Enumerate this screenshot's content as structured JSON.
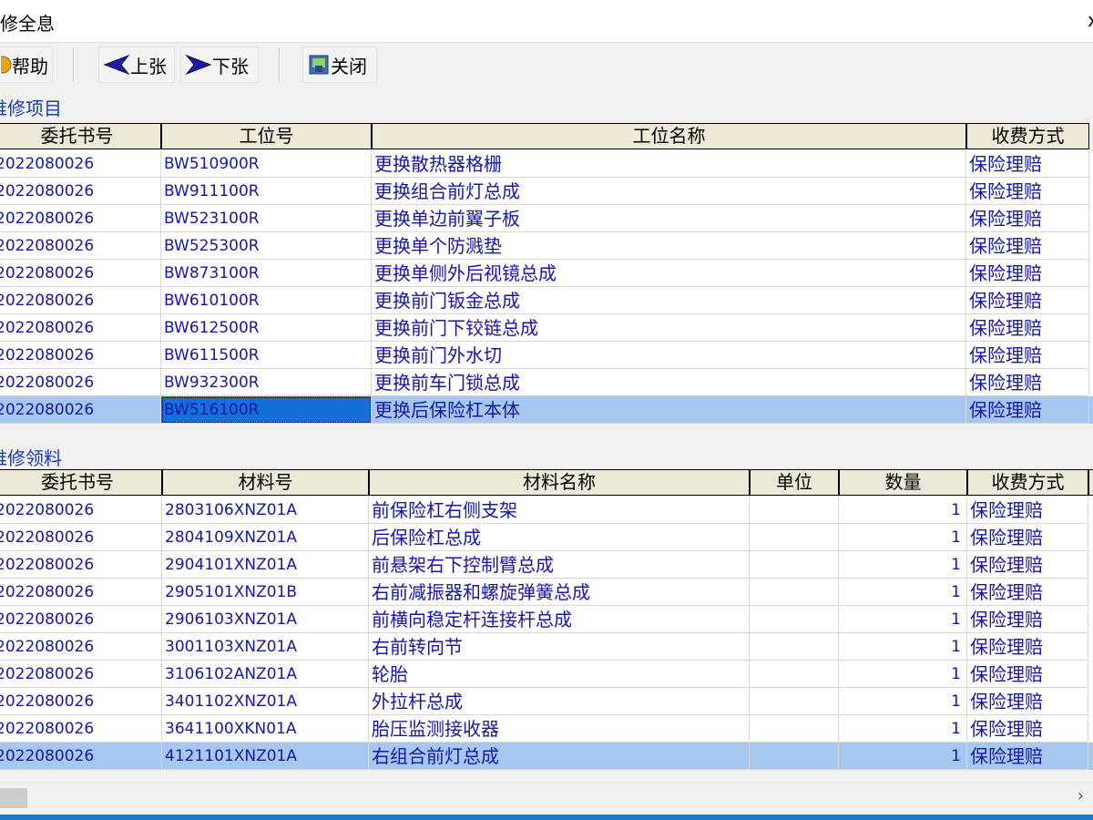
{
  "window": {
    "title": "修全息",
    "close_glyph": "x"
  },
  "toolbar": {
    "help_label": "帮助",
    "prev_label": "上张",
    "next_label": "下张",
    "close_label": "关闭"
  },
  "repair_items": {
    "section_label": "维修项目",
    "columns": [
      "委托书号",
      "工位号",
      "工位名称",
      "收费方式"
    ],
    "rows": [
      [
        "2022080026",
        "BW510900R",
        "更换散热器格栅",
        "保险理赔"
      ],
      [
        "2022080026",
        "BW911100R",
        "更换组合前灯总成",
        "保险理赔"
      ],
      [
        "2022080026",
        "BW523100R",
        "更换单边前翼子板",
        "保险理赔"
      ],
      [
        "2022080026",
        "BW525300R",
        "更换单个防溅垫",
        "保险理赔"
      ],
      [
        "2022080026",
        "BW873100R",
        "更换单侧外后视镜总成",
        "保险理赔"
      ],
      [
        "2022080026",
        "BW610100R",
        "更换前门钣金总成",
        "保险理赔"
      ],
      [
        "2022080026",
        "BW612500R",
        "更换前门下铰链总成",
        "保险理赔"
      ],
      [
        "2022080026",
        "BW611500R",
        "更换前门外水切",
        "保险理赔"
      ],
      [
        "2022080026",
        "BW932300R",
        "更换前车门锁总成",
        "保险理赔"
      ],
      [
        "2022080026",
        "BW516100R",
        "更换后保险杠本体",
        "保险理赔"
      ]
    ]
  },
  "materials": {
    "section_label": "维修领料",
    "columns": [
      "委托书号",
      "材料号",
      "材料名称",
      "单位",
      "数量",
      "收费方式"
    ],
    "rows": [
      [
        "2022080026",
        "2803106XNZ01A",
        "前保险杠右侧支架",
        "",
        "1",
        "保险理赔"
      ],
      [
        "2022080026",
        "2804109XNZ01A",
        "后保险杠总成",
        "",
        "1",
        "保险理赔"
      ],
      [
        "2022080026",
        "2904101XNZ01A",
        "前悬架右下控制臂总成",
        "",
        "1",
        "保险理赔"
      ],
      [
        "2022080026",
        "2905101XNZ01B",
        "右前减振器和螺旋弹簧总成",
        "",
        "1",
        "保险理赔"
      ],
      [
        "2022080026",
        "2906103XNZ01A",
        "前横向稳定杆连接杆总成",
        "",
        "1",
        "保险理赔"
      ],
      [
        "2022080026",
        "3001103XNZ01A",
        "右前转向节",
        "",
        "1",
        "保险理赔"
      ],
      [
        "2022080026",
        "3106102ANZ01A",
        "轮胎",
        "",
        "1",
        "保险理赔"
      ],
      [
        "2022080026",
        "3401102XNZ01A",
        "外拉杆总成",
        "",
        "1",
        "保险理赔"
      ],
      [
        "2022080026",
        "3641100XKN01A",
        "胎压监测接收器",
        "",
        "1",
        "保险理赔"
      ],
      [
        "2022080026",
        "4121101XNZ01A",
        "右组合前灯总成",
        "",
        "1",
        "保险理赔"
      ]
    ]
  },
  "scrollbar": {
    "right_arrow": "›"
  },
  "colors": {
    "cell_text": "#1616a8",
    "selected_row": "#a6c8f0",
    "focused_cell": "#1470d8",
    "header_bg": "#ece9d8",
    "section_label": "#1a3cae"
  },
  "icons": [
    "help-icon",
    "arrow-left-icon",
    "arrow-right-icon",
    "close-window-icon"
  ]
}
